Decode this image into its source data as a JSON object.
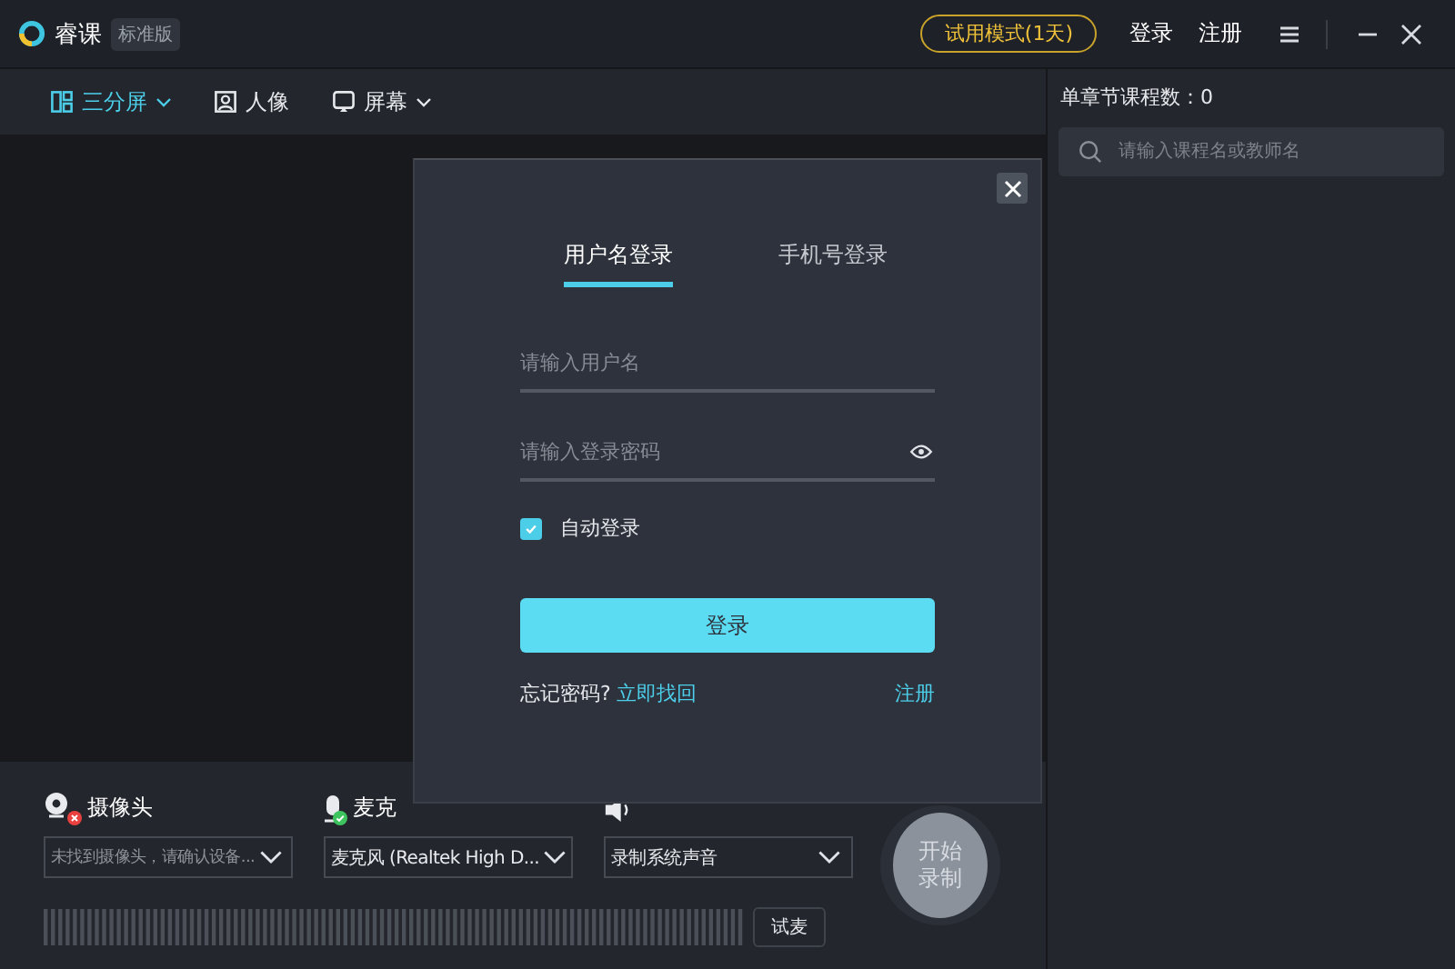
{
  "title_bar": {
    "app_name": "睿课",
    "edition": "标准版",
    "trial": "试用模式(1天)",
    "login": "登录",
    "register": "注册"
  },
  "modes": [
    {
      "label": "三分屏",
      "selected": true,
      "dropdown": true,
      "kind": "split"
    },
    {
      "label": "人像",
      "selected": false,
      "dropdown": false,
      "kind": "portrait"
    },
    {
      "label": "屏幕",
      "selected": false,
      "dropdown": true,
      "kind": "screen"
    }
  ],
  "devices": [
    {
      "kind": "camera",
      "label": "摄像头",
      "connected": false,
      "value": "未找到摄像头，请确认设备...",
      "muted": true
    },
    {
      "kind": "microphone",
      "label": "麦克",
      "connected": true,
      "value": "麦克风 (Realtek High D...",
      "muted": false
    },
    {
      "kind": "speaker",
      "value": "录制系统声音",
      "muted": false
    }
  ],
  "test_button": "试麦",
  "record_button": "开始录制",
  "course_panel": {
    "count": "单章节课程数：0",
    "search": {
      "placeholder": "请输入课程名或教师名"
    }
  },
  "login_dialog": {
    "tabs": [
      {
        "label": "用户名登录",
        "selected": true
      },
      {
        "label": "手机号登录",
        "selected": false
      }
    ],
    "username": {
      "placeholder": "请输入用户名"
    },
    "password": {
      "placeholder": "请输入登录密码"
    },
    "auto_login": {
      "label": "自动登录",
      "checked": true
    },
    "submit": "登录",
    "forgot": "忘记密码?",
    "recover": "立即找回",
    "register": "注册"
  }
}
